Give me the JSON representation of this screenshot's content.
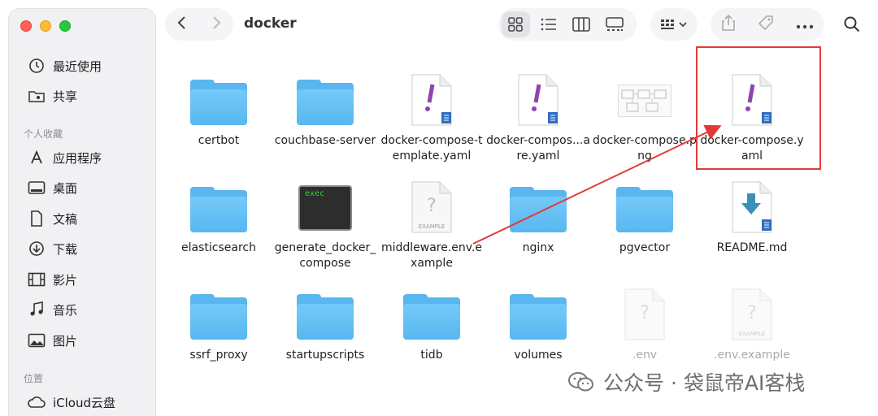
{
  "window": {
    "title": "docker"
  },
  "sidebar": {
    "items_top": [
      {
        "label": "最近使用",
        "icon": "clock-icon"
      },
      {
        "label": "共享",
        "icon": "shared-folder-icon"
      }
    ],
    "favorites_header": "个人收藏",
    "favorites": [
      {
        "label": "应用程序",
        "icon": "applications-icon"
      },
      {
        "label": "桌面",
        "icon": "desktop-icon"
      },
      {
        "label": "文稿",
        "icon": "document-icon"
      },
      {
        "label": "下载",
        "icon": "download-icon"
      },
      {
        "label": "影片",
        "icon": "film-icon"
      },
      {
        "label": "音乐",
        "icon": "music-icon"
      },
      {
        "label": "图片",
        "icon": "image-icon"
      }
    ],
    "locations_header": "位置",
    "locations": [
      {
        "label": "iCloud云盘",
        "icon": "cloud-icon"
      }
    ]
  },
  "toolbar": {
    "view_modes": [
      "icon-view-icon",
      "list-view-icon",
      "column-view-icon",
      "gallery-view-icon"
    ],
    "selected_view": "icon-view-icon"
  },
  "files": [
    {
      "name": "certbot",
      "kind": "folder"
    },
    {
      "name": "couchbase-server",
      "kind": "folder"
    },
    {
      "name": "docker-compose-template.yaml",
      "kind": "yaml"
    },
    {
      "name": "docker-compos...are.yaml",
      "kind": "yaml"
    },
    {
      "name": "docker-compose.png",
      "kind": "png"
    },
    {
      "name": "docker-compose.yaml",
      "kind": "yaml"
    },
    {
      "name": "elasticsearch",
      "kind": "folder"
    },
    {
      "name": "generate_docker_compose",
      "kind": "exec",
      "badge": "exec"
    },
    {
      "name": "middleware.env.example",
      "kind": "unknown",
      "badge": "EXAMPLE"
    },
    {
      "name": "nginx",
      "kind": "folder"
    },
    {
      "name": "pgvector",
      "kind": "folder"
    },
    {
      "name": "README.md",
      "kind": "markdown"
    },
    {
      "name": "ssrf_proxy",
      "kind": "folder"
    },
    {
      "name": "startupscripts",
      "kind": "folder"
    },
    {
      "name": "tidb",
      "kind": "folder"
    },
    {
      "name": "volumes",
      "kind": "folder"
    },
    {
      "name": ".env",
      "kind": "unknown-dim"
    },
    {
      "name": ".env.example",
      "kind": "unknown-dim",
      "badge": "EXAMPLE"
    }
  ],
  "watermark": "公众号 · 袋鼠帝AI客栈",
  "colors": {
    "folder": "#5ab6ef",
    "highlight": "#e23a3a",
    "yaml_mark": "#8e44ad",
    "doc_badge": "#2f6fbf"
  }
}
